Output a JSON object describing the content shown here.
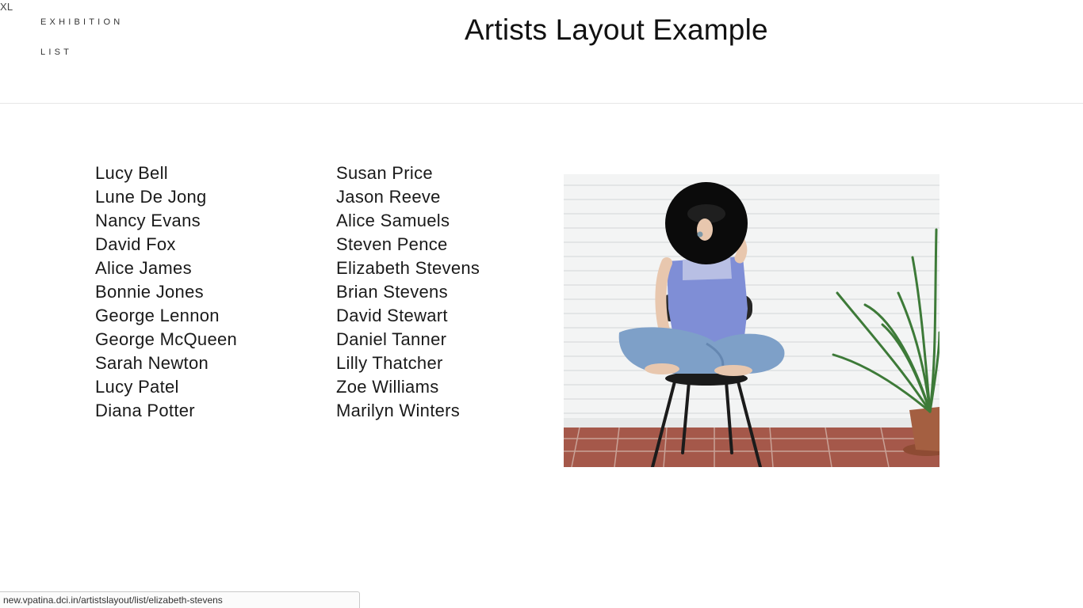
{
  "breakpoint_label": "XL",
  "nav": {
    "exhibition": "EXHIBITION",
    "list": "LIST"
  },
  "page_title": "Artists Layout Example",
  "artists_col1": [
    "Lucy Bell",
    "Lune De Jong",
    "Nancy Evans",
    "David Fox",
    "Alice James",
    "Bonnie Jones",
    "George Lennon",
    "George McQueen",
    "Sarah Newton",
    "Lucy Patel",
    "Diana Potter"
  ],
  "artists_col2": [
    "Susan Price",
    "Jason Reeve",
    "Alice Samuels",
    "Steven Pence",
    "Elizabeth Stevens",
    "Brian Stevens",
    "David Stewart",
    "Daniel Tanner",
    "Lilly Thatcher",
    "Zoe Williams",
    "Marilyn Winters"
  ],
  "status_url": "new.vpatina.dci.in/artistslayout/list/elizabeth-stevens",
  "colors": {
    "text": "#111111",
    "rule": "#e6e6e6",
    "wall": "#f1f2f2",
    "floor": "#a5584a",
    "shirt": "#7f8ed6",
    "jeans": "#7ea0c8",
    "hat": "#0b0b0b",
    "plant": "#3d7a38"
  }
}
